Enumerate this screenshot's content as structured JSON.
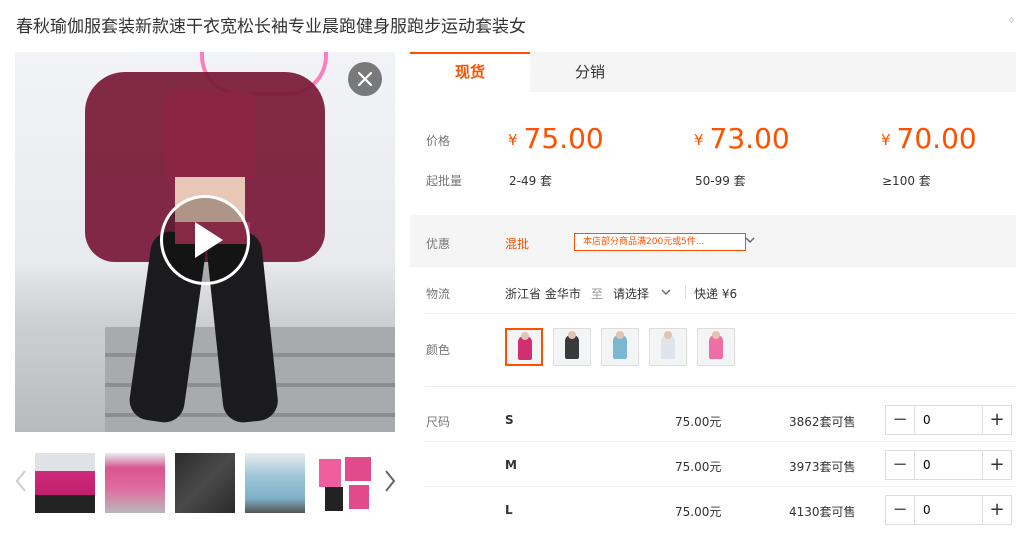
{
  "title": "春秋瑜伽服套装新款速干衣宽松长袖专业晨跑健身服跑步运动套装女",
  "corner_text": "✧",
  "tabs": [
    {
      "label": "现货"
    },
    {
      "label": "分销"
    }
  ],
  "price_section": {
    "price_label": "价格",
    "moq_label": "起批量",
    "currency": "¥",
    "tiers": [
      {
        "price": "75.00",
        "qty": "2-49 套"
      },
      {
        "price": "73.00",
        "qty": "50-99 套"
      },
      {
        "price": "70.00",
        "qty": "≥100 套"
      }
    ]
  },
  "promo": {
    "label": "优惠",
    "link": "混批",
    "coupon_text": "本店部分商品满200元或5件..."
  },
  "logistics": {
    "label": "物流",
    "origin": "浙江省 金华市",
    "to": "至",
    "destination": "请选择",
    "shipping": "快递 ¥6"
  },
  "color": {
    "label": "颜色",
    "options": [
      "#d0306f",
      "#3a3a3a",
      "#7cb7d2",
      "#dfe4ea",
      "#ef6ea4"
    ],
    "selected_index": 0
  },
  "size": {
    "label": "尺码",
    "rows": [
      {
        "size": "S",
        "price": "75.00元",
        "stock": "3862套可售",
        "quantity": "0"
      },
      {
        "size": "M",
        "price": "75.00元",
        "stock": "3973套可售",
        "quantity": "0"
      },
      {
        "size": "L",
        "price": "75.00元",
        "stock": "4130套可售",
        "quantity": "0"
      }
    ]
  },
  "icons": {
    "play": "play-icon",
    "close": "close-icon",
    "prev": "chevron-left-icon",
    "next": "chevron-right-icon"
  },
  "accent_color": "#ff5000"
}
